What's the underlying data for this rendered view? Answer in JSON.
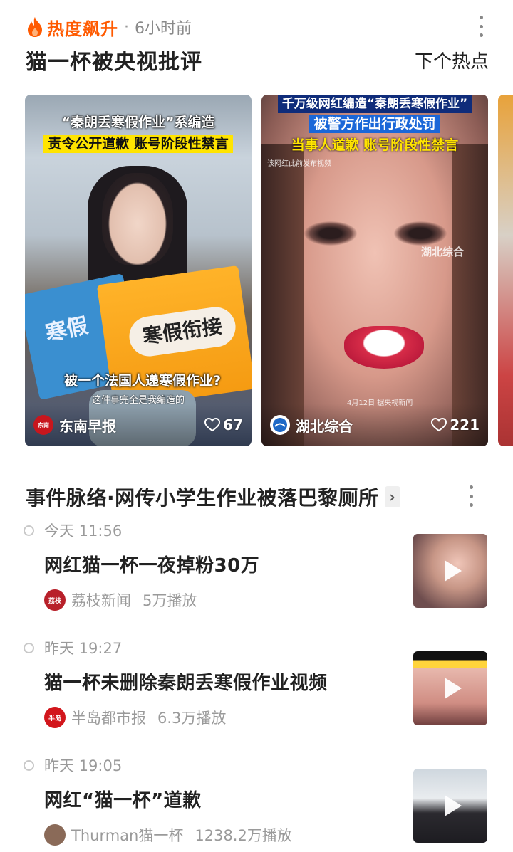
{
  "header": {
    "tag": "热度飙升",
    "separator": "·",
    "time": "6小时前",
    "topic_title": "猫一杯被央视批评",
    "next_hot": "下个热点"
  },
  "cards": [
    {
      "headline_1": "“秦朗丢寒假作业”系编造",
      "headline_2": "责令公开道歉 账号阶段性禁言",
      "book_left": "寒假",
      "book_right": "寒假衔接",
      "subtitle": "被一个法国人递寒假作业?",
      "subtitle_2": "这件事完全是我编造的",
      "source": "东南早报",
      "likes": "67"
    },
    {
      "headline_1": "千万级网红编造“秦朗丢寒假作业”",
      "headline_2": "被警方作出行政处罚",
      "headline_3": "当事人道歉 账号阶段性禁言",
      "note": "该网红此前发布视频",
      "watermark": "湖北综合",
      "date_note": "4月12日 据央视新闻",
      "source": "湖北综合",
      "likes": "221"
    }
  ],
  "events": {
    "title": "事件脉络·网传小学生作业被落巴黎厕所",
    "chevron": "›",
    "items": [
      {
        "time": "今天 11:56",
        "title": "网红猫一杯一夜掉粉30万",
        "source": "荔枝新闻",
        "plays": "5万播放",
        "logo_color": "#b8202a"
      },
      {
        "time": "昨天 19:27",
        "title": "猫一杯未删除秦朗丢寒假作业视频",
        "source": "半岛都市报",
        "plays": "6.3万播放",
        "logo_color": "#d2161c"
      },
      {
        "time": "昨天 19:05",
        "title": "网红“猫一杯”道歉",
        "source": "Thurman猫一杯",
        "plays": "1238.2万播放",
        "logo_color": "#8a6a58"
      }
    ]
  },
  "colors": {
    "accent": "#ff5a00",
    "text": "#222222",
    "muted": "#9a9a9a"
  }
}
